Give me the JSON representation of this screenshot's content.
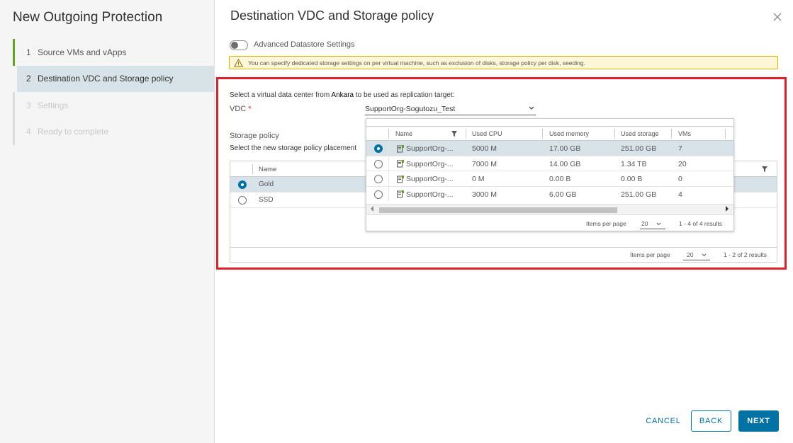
{
  "wizard": {
    "title": "New Outgoing Protection",
    "steps": [
      {
        "num": "1",
        "label": "Source VMs and vApps",
        "state": "done"
      },
      {
        "num": "2",
        "label": "Destination VDC and Storage policy",
        "state": "active"
      },
      {
        "num": "3",
        "label": "Settings",
        "state": "disabled"
      },
      {
        "num": "4",
        "label": "Ready to complete",
        "state": "disabled"
      }
    ]
  },
  "page": {
    "title": "Destination VDC and Storage policy",
    "toggle_label": "Advanced Datastore Settings",
    "warning": "You can specify dedicated storage settings on per virtual machine, such as exclusion of disks, storage policy per disk, seeding.",
    "intro_prefix": "Select a virtual data center from ",
    "intro_site": "Ankara",
    "intro_suffix": " to be used as replication target:",
    "vdc_label": "VDC",
    "vdc_required": "*",
    "vdc_value": "SupportOrg-Sogutozu_Test",
    "storage_policy_title": "Storage policy",
    "storage_policy_desc": "Select the new storage policy placement"
  },
  "vdc_grid": {
    "columns": [
      "Name",
      "Used CPU",
      "Used memory",
      "Used storage",
      "VMs"
    ],
    "rows": [
      {
        "name": "SupportOrg-...",
        "cpu": "5000 M",
        "memory": "17.00 GB",
        "storage": "251.00 GB",
        "vms": "7",
        "selected": true
      },
      {
        "name": "SupportOrg-...",
        "cpu": "7000 M",
        "memory": "14.00 GB",
        "storage": "1.34 TB",
        "vms": "20",
        "selected": false
      },
      {
        "name": "SupportOrg-...",
        "cpu": "0 M",
        "memory": "0.00 B",
        "storage": "0.00 B",
        "vms": "0",
        "selected": false
      },
      {
        "name": "SupportOrg-...",
        "cpu": "3000 M",
        "memory": "6.00 GB",
        "storage": "251.00 GB",
        "vms": "4",
        "selected": false
      }
    ],
    "items_per_page_label": "Items per page",
    "items_per_page": "20",
    "count": "1 - 4 of 4 results"
  },
  "sp_grid": {
    "column": "Name",
    "rows": [
      {
        "name": "Gold",
        "selected": true
      },
      {
        "name": "SSD",
        "selected": false
      }
    ],
    "items_per_page_label": "Items per page",
    "items_per_page": "20",
    "count": "1 - 2 of 2 results"
  },
  "buttons": {
    "cancel": "CANCEL",
    "back": "BACK",
    "next": "NEXT"
  },
  "colors": {
    "accent": "#0072a3",
    "step_done": "#62a420",
    "highlight_border": "#e2202c",
    "warning_bg": "#fef7d7",
    "selected_row": "#d8e3e9"
  },
  "icons": {
    "close": "close-icon",
    "warning": "warning-icon",
    "filter": "filter-icon",
    "vdc": "vdc-icon",
    "chevron": "chevron-down-icon"
  }
}
